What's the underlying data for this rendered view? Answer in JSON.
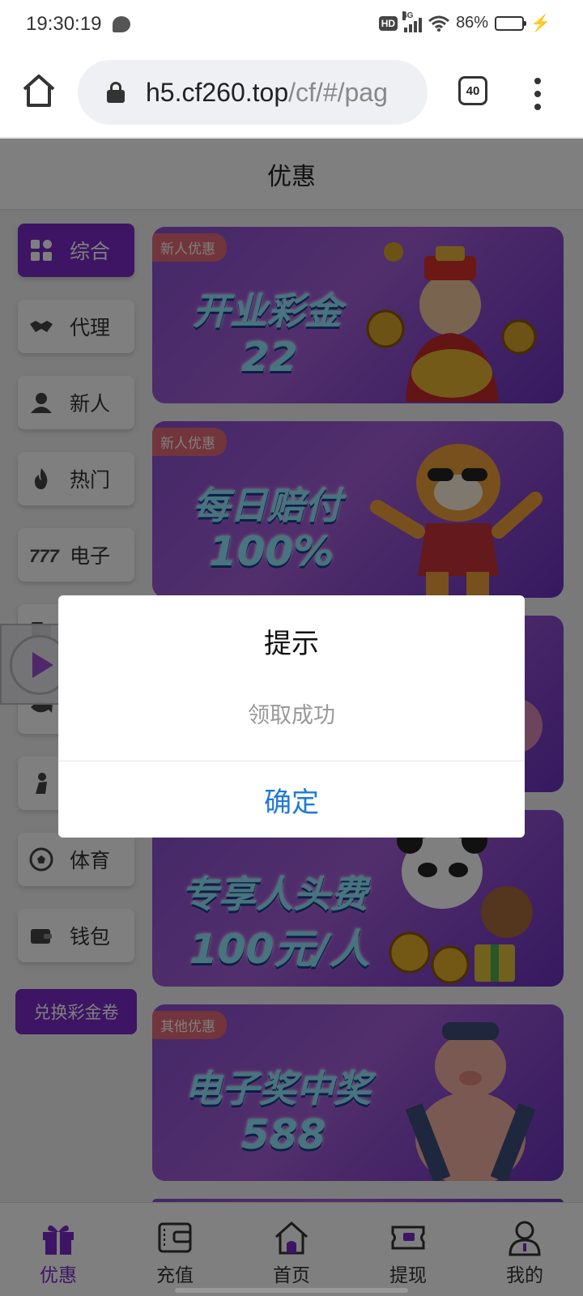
{
  "status_bar": {
    "time": "19:30:19",
    "hd": "HD",
    "network": "4G",
    "battery": "86%",
    "battery_level": 0.86
  },
  "browser": {
    "url_host": "h5.cf260.top",
    "url_path": "/cf/#/pag",
    "tab_count": "40"
  },
  "page": {
    "title": "优惠"
  },
  "sidebar": {
    "items": [
      {
        "label": "综合",
        "icon": "grid-icon",
        "active": true
      },
      {
        "label": "代理",
        "icon": "handshake-icon"
      },
      {
        "label": "新人",
        "icon": "person-icon"
      },
      {
        "label": "热门",
        "icon": "flame-icon"
      },
      {
        "label": "电子",
        "icon": "slot-777-icon"
      },
      {
        "label": "",
        "icon": "cards-icon"
      },
      {
        "label": "",
        "icon": "fish-icon"
      },
      {
        "label": "",
        "icon": "figure-icon"
      },
      {
        "label": "体育",
        "icon": "soccer-ball-icon"
      },
      {
        "label": "钱包",
        "icon": "wallet-icon"
      }
    ],
    "redeem_label": "兑换彩金卷"
  },
  "banners": [
    {
      "tag": "新人优惠",
      "line1": "开业彩金",
      "line2": "22",
      "art": "fortune-god-icon"
    },
    {
      "tag": "新人优惠",
      "line1": "每日赔付",
      "line2": "100%",
      "art": "tiger-icon"
    },
    {
      "tag": "",
      "line1": "",
      "line2": "",
      "art": "character-icon"
    },
    {
      "tag": "",
      "line1": "专享人头费",
      "line2": "100元/人",
      "art": "panda-icon"
    },
    {
      "tag": "其他优惠",
      "line1": "电子奖中奖",
      "line2": "588",
      "art": "pig-icon"
    }
  ],
  "dialog": {
    "title": "提示",
    "message": "领取成功",
    "confirm_label": "确定"
  },
  "bottom_nav": [
    {
      "label": "优惠",
      "icon": "gift-icon",
      "active": true
    },
    {
      "label": "充值",
      "icon": "wallet-card-icon"
    },
    {
      "label": "首页",
      "icon": "home-icon"
    },
    {
      "label": "提现",
      "icon": "ticket-icon"
    },
    {
      "label": "我的",
      "icon": "user-icon"
    }
  ],
  "colors": {
    "accent": "#7a2bc9",
    "dialog_confirm": "#1f7ad6",
    "banner_tag": "#e46a76"
  }
}
